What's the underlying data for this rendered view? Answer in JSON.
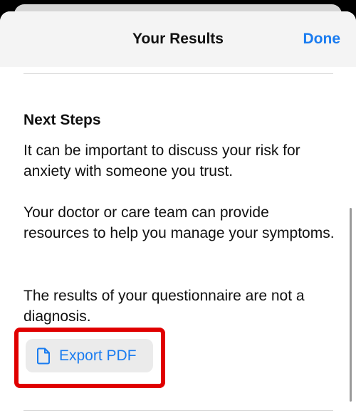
{
  "nav": {
    "title": "Your Results",
    "done_label": "Done"
  },
  "content": {
    "heading": "Next Steps",
    "paragraphs": [
      "It can be important to discuss your risk for anxiety with someone you trust.",
      "Your doctor or care team can provide resources to help you manage your symptoms.",
      "The results of your questionnaire are not a diagnosis."
    ]
  },
  "export": {
    "label": "Export PDF",
    "icon": "document-icon"
  },
  "colors": {
    "accent": "#1a7cf0",
    "highlight": "#e00000",
    "button_bg": "#ebebeb",
    "nav_bg": "#f4f4f4"
  }
}
